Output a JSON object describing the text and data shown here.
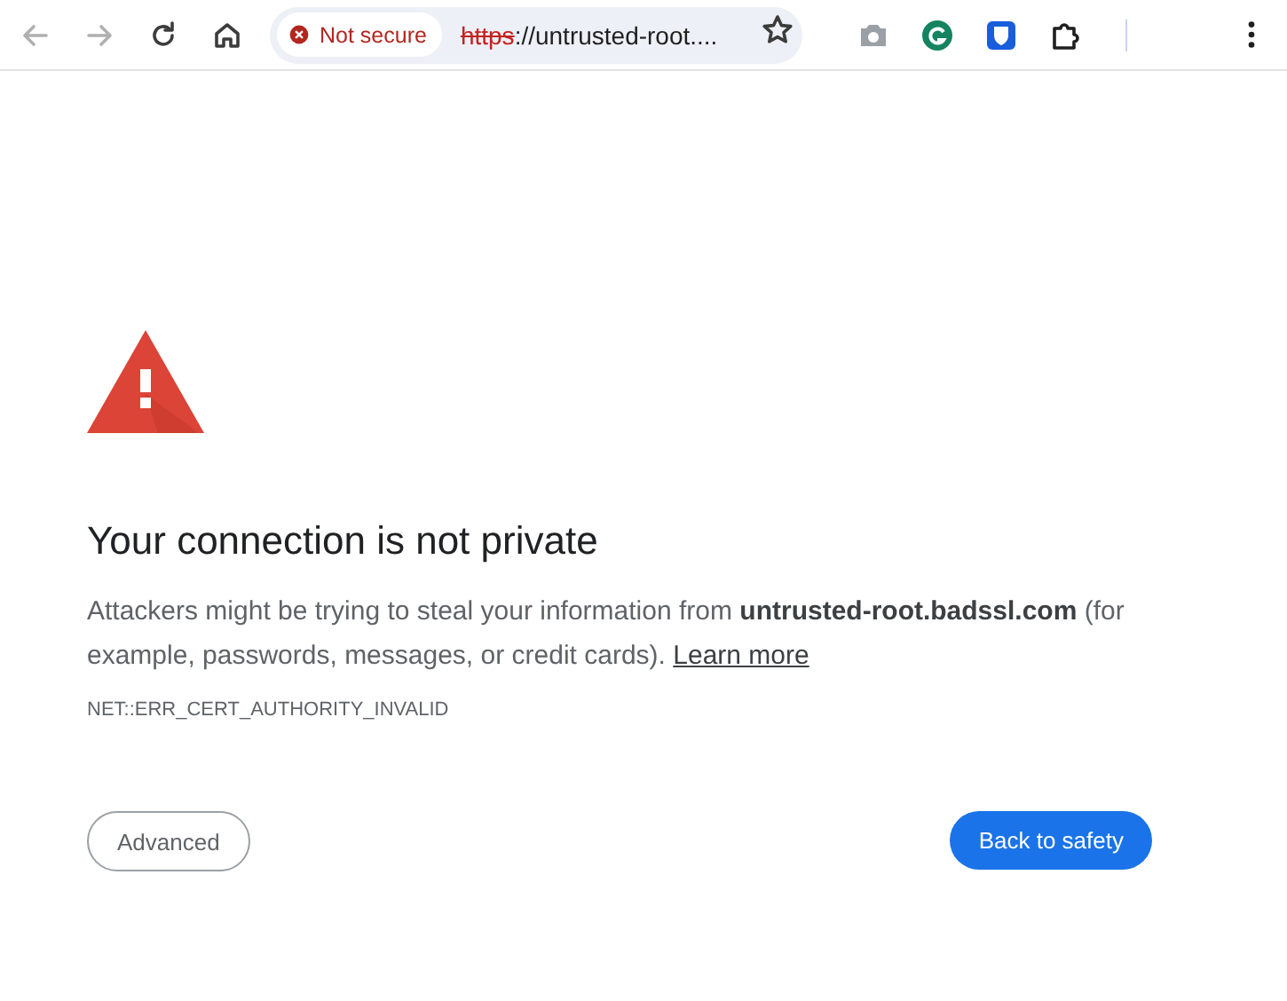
{
  "toolbar": {
    "security_chip": "Not secure",
    "url_scheme": "https",
    "url_rest": "://untrusted-root...."
  },
  "interstitial": {
    "title": "Your connection is not private",
    "message": "Attackers might be trying to steal your information from **untrusted-root.badssl.com** (for example, passwords, messages, or credit cards).",
    "link": "Learn more",
    "error_code": "NET::ERR_CERT_AUTHORITY_INVALID",
    "buttons": [
      {
        "label": "Advanced",
        "kind": "secondary"
      },
      {
        "label": "Back to safety",
        "kind": "primary"
      }
    ]
  }
}
